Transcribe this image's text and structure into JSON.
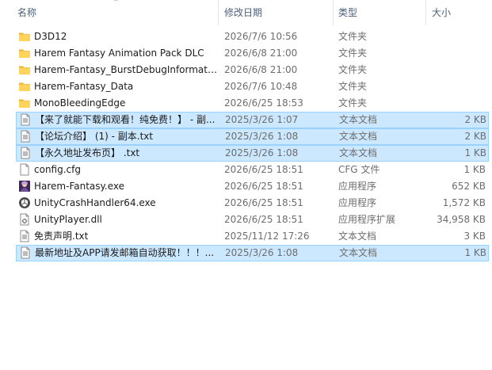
{
  "columns": {
    "name": "名称",
    "date": "修改日期",
    "type": "类型",
    "size": "大小"
  },
  "files": [
    {
      "name": "D3D12",
      "date": "2026/7/6 10:56",
      "type": "文件夹",
      "size": "",
      "icon": "folder-icon",
      "selected": false
    },
    {
      "name": "Harem Fantasy Animation Pack DLC",
      "date": "2026/6/8 21:00",
      "type": "文件夹",
      "size": "",
      "icon": "folder-icon",
      "selected": false
    },
    {
      "name": "Harem-Fantasy_BurstDebugInformati...",
      "date": "2026/6/8 21:00",
      "type": "文件夹",
      "size": "",
      "icon": "folder-icon",
      "selected": false
    },
    {
      "name": "Harem-Fantasy_Data",
      "date": "2026/7/6 10:48",
      "type": "文件夹",
      "size": "",
      "icon": "folder-icon",
      "selected": false
    },
    {
      "name": "MonoBleedingEdge",
      "date": "2026/6/25 18:53",
      "type": "文件夹",
      "size": "",
      "icon": "folder-icon",
      "selected": false
    },
    {
      "name": "【来了就能下载和观看！纯免费！】 - 副...",
      "date": "2025/3/26 1:07",
      "type": "文本文档",
      "size": "2 KB",
      "icon": "text-file-icon",
      "selected": true
    },
    {
      "name": "【论坛介绍】 (1) - 副本.txt",
      "date": "2025/3/26 1:08",
      "type": "文本文档",
      "size": "2 KB",
      "icon": "text-file-icon",
      "selected": true
    },
    {
      "name": "【永久地址发布页】 .txt",
      "date": "2025/3/26 1:08",
      "type": "文本文档",
      "size": "1 KB",
      "icon": "text-file-icon",
      "selected": true
    },
    {
      "name": "config.cfg",
      "date": "2026/6/25 18:51",
      "type": "CFG 文件",
      "size": "1 KB",
      "icon": "generic-file-icon",
      "selected": false
    },
    {
      "name": "Harem-Fantasy.exe",
      "date": "2026/6/25 18:51",
      "type": "应用程序",
      "size": "652 KB",
      "icon": "app-icon",
      "selected": false
    },
    {
      "name": "UnityCrashHandler64.exe",
      "date": "2026/6/25 18:51",
      "type": "应用程序",
      "size": "1,572 KB",
      "icon": "unity-icon",
      "selected": false
    },
    {
      "name": "UnityPlayer.dll",
      "date": "2026/6/25 18:51",
      "type": "应用程序扩展",
      "size": "34,958 KB",
      "icon": "dll-icon",
      "selected": false
    },
    {
      "name": "免责声明.txt",
      "date": "2025/11/12 17:26",
      "type": "文本文档",
      "size": "3 KB",
      "icon": "text-file-icon",
      "selected": false
    },
    {
      "name": "最新地址及APP请发邮箱自动获取！！！...",
      "date": "2025/3/26 1:08",
      "type": "文本文档",
      "size": "1 KB",
      "icon": "text-file-icon",
      "selected": true
    }
  ]
}
